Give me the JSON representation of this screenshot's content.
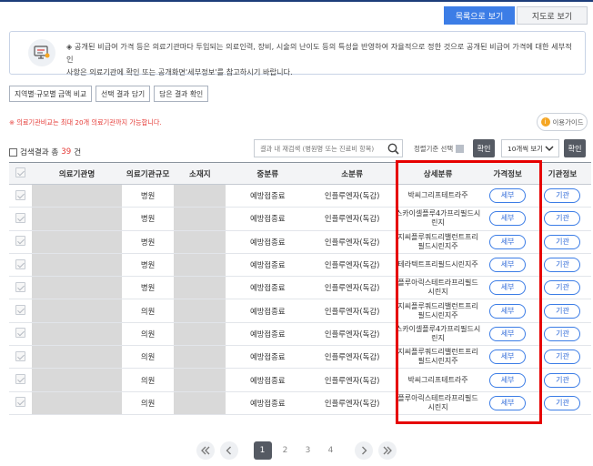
{
  "view_toggle": {
    "list": "목록으로 보기",
    "map": "지도로 보기",
    "active": "list"
  },
  "notice": {
    "line1": "◈ 공개된 비급여 가격 등은 의료기관마다 투입되는 의료인력, 장비, 시술의 난이도 등의 특성을 반영하여 자율적으로 정한 것으로 공개된 비급여 가격에 대한 세부적인",
    "line2": "사항은 의료기관에 확인 또는 공개화면'세부정보'를 참고하시기 바랍니다.",
    "icon": "monitor-info-icon"
  },
  "tools": {
    "compare_by_region": "지역별·규모별 금액 비교",
    "save_selected": "선택 결과 담기",
    "view_saved": "담은 결과 확인"
  },
  "warning": "※ 의료기관비교는 최대 20개 의료기관까지 가능합니다.",
  "guide_label": "이용가이드",
  "results": {
    "prefix": "검색결과 총",
    "count": "39",
    "suffix": "건"
  },
  "search": {
    "placeholder": "결과 내 재검색 (병원명 또는 진료비 항목)"
  },
  "sort_label": "정렬기준 선택",
  "confirm_label": "확인",
  "page_size": "10개씩 보기",
  "columns": [
    "의료기관명",
    "의료기관규모",
    "소재지",
    "중분류",
    "소분류",
    "상세분류",
    "가격정보",
    "기관정보"
  ],
  "rows": [
    {
      "size": "병원",
      "mid": "예방접종료",
      "sub": "인플루엔자(독감)",
      "detail": "박씨그리프테트라주",
      "price": "세부",
      "org": "기관"
    },
    {
      "size": "병원",
      "mid": "예방접종료",
      "sub": "인플루엔자(독감)",
      "detail": "스카이셀플루4가프리필드시린지",
      "price": "세부",
      "org": "기관"
    },
    {
      "size": "병원",
      "mid": "예방접종료",
      "sub": "인플루엔자(독감)",
      "detail": "지씨플루쿼드리밸런트프리필드시린지주",
      "price": "세부",
      "org": "기관"
    },
    {
      "size": "병원",
      "mid": "예방접종료",
      "sub": "인플루엔자(독감)",
      "detail": "테라텍트프리필드시린지주",
      "price": "세부",
      "org": "기관"
    },
    {
      "size": "병원",
      "mid": "예방접종료",
      "sub": "인플루엔자(독감)",
      "detail": "플루아릭스테트라프리필드시린지",
      "price": "세부",
      "org": "기관"
    },
    {
      "size": "의원",
      "mid": "예방접종료",
      "sub": "인플루엔자(독감)",
      "detail": "지씨플루쿼드리밸런트프리필드시린지주",
      "price": "세부",
      "org": "기관"
    },
    {
      "size": "의원",
      "mid": "예방접종료",
      "sub": "인플루엔자(독감)",
      "detail": "스카이셀플루4가프리필드시린지",
      "price": "세부",
      "org": "기관"
    },
    {
      "size": "의원",
      "mid": "예방접종료",
      "sub": "인플루엔자(독감)",
      "detail": "지씨플루쿼드리밸런트프리필드시린지주",
      "price": "세부",
      "org": "기관"
    },
    {
      "size": "의원",
      "mid": "예방접종료",
      "sub": "인플루엔자(독감)",
      "detail": "박씨그리프테트라주",
      "price": "세부",
      "org": "기관"
    },
    {
      "size": "의원",
      "mid": "예방접종료",
      "sub": "인플루엔자(독감)",
      "detail": "플루아릭스테트라프리필드시린지",
      "price": "세부",
      "org": "기관"
    }
  ],
  "pagination": {
    "pages": [
      "1",
      "2",
      "3",
      "4"
    ],
    "current": "1"
  },
  "colors": {
    "accent": "#3c7de6",
    "highlight": "#e60000",
    "dark_button": "#555a63",
    "warning": "#e53935"
  }
}
